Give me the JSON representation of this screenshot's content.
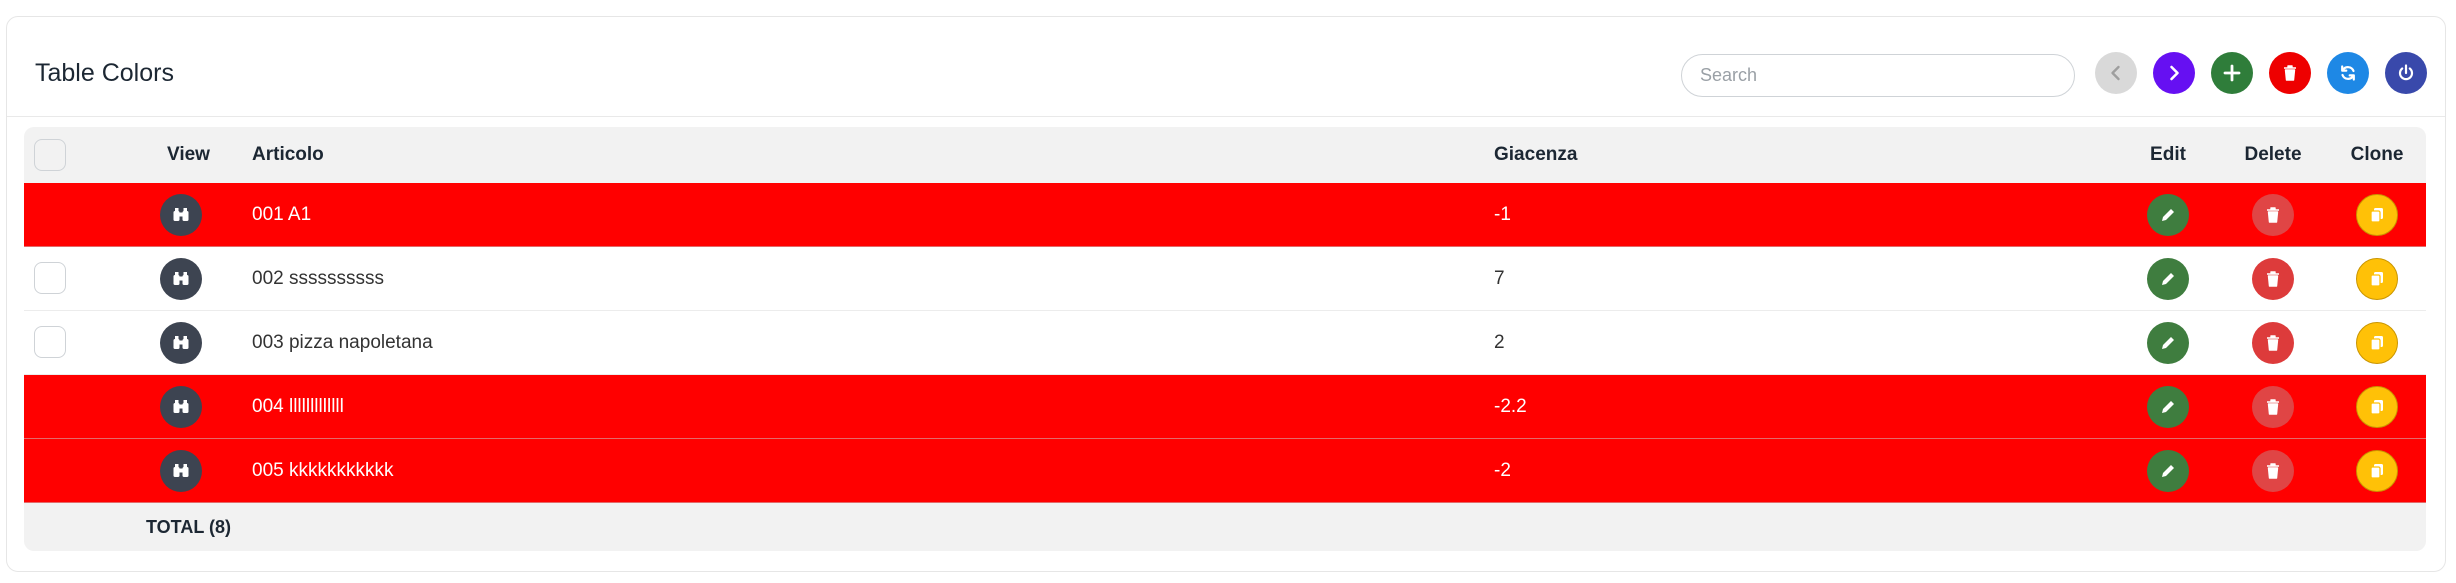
{
  "header": {
    "title": "Table Colors",
    "search_placeholder": "Search",
    "toolbar": [
      {
        "name": "prev-page-button",
        "icon": "chevron-left-icon",
        "color": "#d9d9d9"
      },
      {
        "name": "next-page-button",
        "icon": "chevron-right-icon",
        "color": "#6610f2"
      },
      {
        "name": "add-button",
        "icon": "plus-icon",
        "color": "#2f7d3a"
      },
      {
        "name": "delete-button",
        "icon": "trash-icon",
        "color": "#ee0000"
      },
      {
        "name": "refresh-button",
        "icon": "refresh-icon",
        "color": "#1e88e5"
      },
      {
        "name": "power-button",
        "icon": "power-icon",
        "color": "#3949ab"
      }
    ]
  },
  "table": {
    "columns": {
      "view": "View",
      "articolo": "Articolo",
      "giacenza": "Giacenza",
      "edit": "Edit",
      "delete": "Delete",
      "clone": "Clone"
    },
    "rows": [
      {
        "articolo": "001 A1",
        "giacenza": "-1",
        "highlight": true
      },
      {
        "articolo": "002 ssssssssss",
        "giacenza": "7",
        "highlight": false
      },
      {
        "articolo": "003 pizza napoletana",
        "giacenza": "2",
        "highlight": false
      },
      {
        "articolo": "004 lllllllllllll",
        "giacenza": "-2.2",
        "highlight": true
      },
      {
        "articolo": "005 kkkkkkkkkkk",
        "giacenza": "-2",
        "highlight": true
      }
    ],
    "footer": "TOTAL (8)"
  },
  "colors": {
    "highlight_row": "#ff0000",
    "view_button": "#3d4451",
    "edit_button": "#3f7d3f",
    "delete_button": "#dd3b3b",
    "clone_button": "#ffc107"
  }
}
